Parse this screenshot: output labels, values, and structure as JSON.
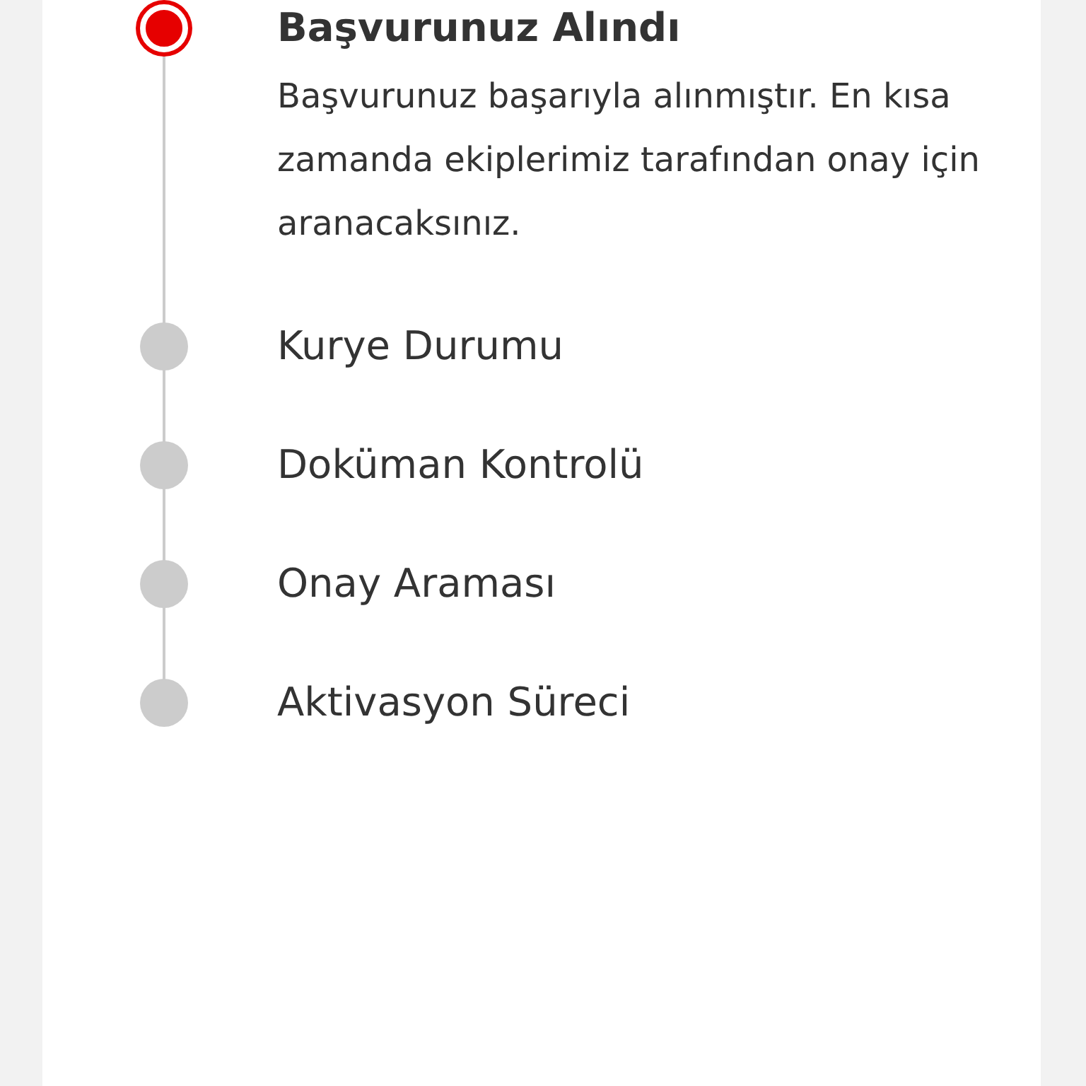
{
  "steps": [
    {
      "title": "Başvurunuz Alındı",
      "active": true,
      "description": "Başvurunuz başarıyla alınmıştır. En kısa zamanda ekiplerimiz tarafından onay için aranacaksınız."
    },
    {
      "title": "Kurye Durumu",
      "active": false
    },
    {
      "title": "Doküman Kontrolü",
      "active": false
    },
    {
      "title": "Onay Araması",
      "active": false
    },
    {
      "title": "Aktivasyon Süreci",
      "active": false
    }
  ]
}
